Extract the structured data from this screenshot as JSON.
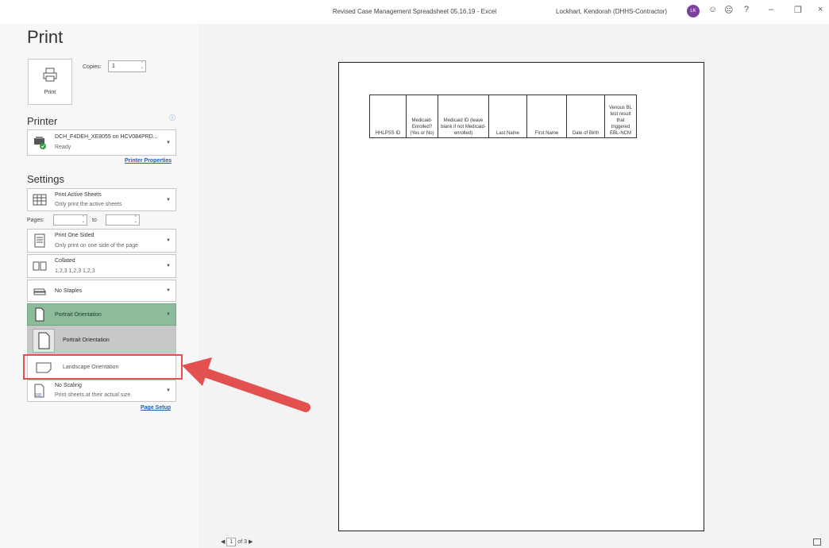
{
  "window": {
    "doc_title": "Revised Case Management Spreadsheet 05.16.19  -  Excel",
    "user_name": "Lockhart, Kendorah (DHHS-Contractor)",
    "avatar_initials": "LK",
    "help_label": "?"
  },
  "page_title": "Print",
  "print_button": {
    "label": "Print"
  },
  "copies": {
    "label": "Copies:",
    "value": "1"
  },
  "printer": {
    "header": "Printer",
    "name": "DCH_F4DEH_XE8055 on HCV084PRD...",
    "status": "Ready",
    "properties_link": "Printer Properties"
  },
  "settings": {
    "header": "Settings",
    "print_what": {
      "title": "Print Active Sheets",
      "subtitle": "Only print the active sheets"
    },
    "pages_label": "Pages:",
    "pages_to_label": "to",
    "sides": {
      "title": "Print One Sided",
      "subtitle": "Only print on one side of the page"
    },
    "collation": {
      "title": "Collated",
      "subtitle": "1,2,3   1,2,3   1,2,3"
    },
    "staples": {
      "title": "No Staples"
    },
    "orientation": {
      "title": "Portrait Orientation"
    },
    "orientation_menu": {
      "portrait": "Portrait Orientation",
      "landscape": "Landscape Orientation"
    },
    "scaling": {
      "title": "No Scaling",
      "subtitle": "Print sheets at their actual size",
      "icon_label": "100"
    },
    "page_setup_link": "Page Setup"
  },
  "sheet_headers": [
    "HHLPSS ID",
    "Medicaid-Enrolled? (Yes or No)",
    "Medicaid ID (leave blank if not Medicaid-enrolled)",
    "Last Name",
    "First Name",
    "Date of Birth",
    "Venous BL test result that triggered EBL-NCM"
  ],
  "pager": {
    "current": "1",
    "of_label": "of 3"
  },
  "colors": {
    "accent_green": "#8dbc9c",
    "highlight_red": "#e2514f",
    "link_blue": "#2461a9"
  }
}
